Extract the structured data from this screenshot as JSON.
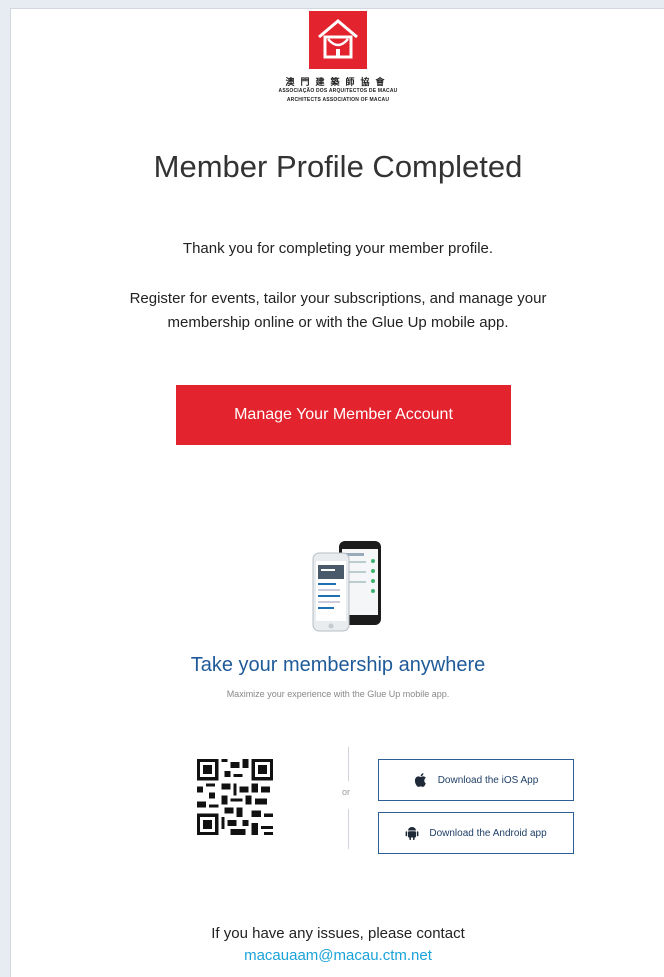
{
  "org": {
    "name_zh": "澳門建築師協會",
    "name_pt": "ASSOCIAÇÃO DOS ARQUITECTOS DE MACAU",
    "name_en": "ARCHITECTS ASSOCIATION OF MACAU",
    "brand_color": "#e3232e"
  },
  "header": {
    "title": "Member Profile Completed"
  },
  "body": {
    "thanks": "Thank you for completing your member profile.",
    "register_line1": "Register for events, tailor your subscriptions, and manage your",
    "register_line2": "membership online or with the Glue Up mobile app."
  },
  "cta": {
    "label": "Manage Your Member Account",
    "color": "#e3232e"
  },
  "app_promo": {
    "icon": "mobile-app-phones",
    "title": "Take your membership anywhere",
    "subtitle": "Maximize your experience with the Glue Up mobile app.",
    "or_label": "or",
    "ios_label": "Download the iOS App",
    "ios_icon": "apple-icon",
    "android_label": "Download the Android app",
    "android_icon": "android-icon",
    "title_color": "#1f5a99"
  },
  "footer": {
    "contact_text": "If you have any issues, please contact",
    "email": "macauaam@macau.ctm.net",
    "link_color": "#1aa3d8"
  }
}
